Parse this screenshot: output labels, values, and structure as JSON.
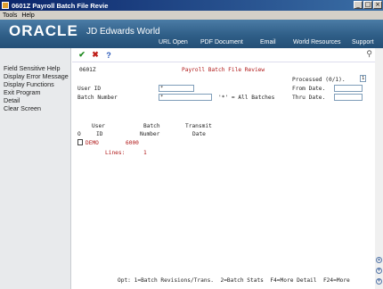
{
  "window": {
    "title": "0601Z   Payroll Batch File Revie"
  },
  "menu": {
    "items": [
      "Tools",
      "Help"
    ]
  },
  "header": {
    "logo": "ORACLE",
    "product": "JD Edwards World",
    "nav": [
      "URL Open",
      "PDF Document",
      "Email",
      "World Resources",
      "Support"
    ]
  },
  "sidebar": {
    "items": [
      "Field Sensitive Help",
      "Display Error Message",
      "Display Functions",
      "Exit Program",
      "Detail",
      "Clear Screen"
    ]
  },
  "form": {
    "program_id": "0601Z",
    "screen_title": "Payroll Batch File Review",
    "processed_label": "Processed (0/1).",
    "processed_value": "1",
    "from_date_label": "From Date.",
    "from_date_value": "",
    "thru_date_label": "Thru Date.",
    "thru_date_value": "",
    "user_id_label": "User ID",
    "user_id_value": "*",
    "batch_number_label": "Batch Number",
    "batch_number_value": "*",
    "all_batches_hint": "'*' = All Batches"
  },
  "grid": {
    "header_row1": [
      "User",
      "Batch",
      "Transmit"
    ],
    "header_row2": [
      "O",
      "ID",
      "Number",
      "Date"
    ],
    "rows": [
      {
        "option": "",
        "user_id": "DEMO",
        "batch_number": "6000",
        "transmit_date": ""
      }
    ],
    "lines_label": "Lines:",
    "lines_value": "1"
  },
  "footer": {
    "options": "Opt: 1=Batch Revisions/Trans.  2=Batch Stats  F4=More Detail  F24=More"
  }
}
